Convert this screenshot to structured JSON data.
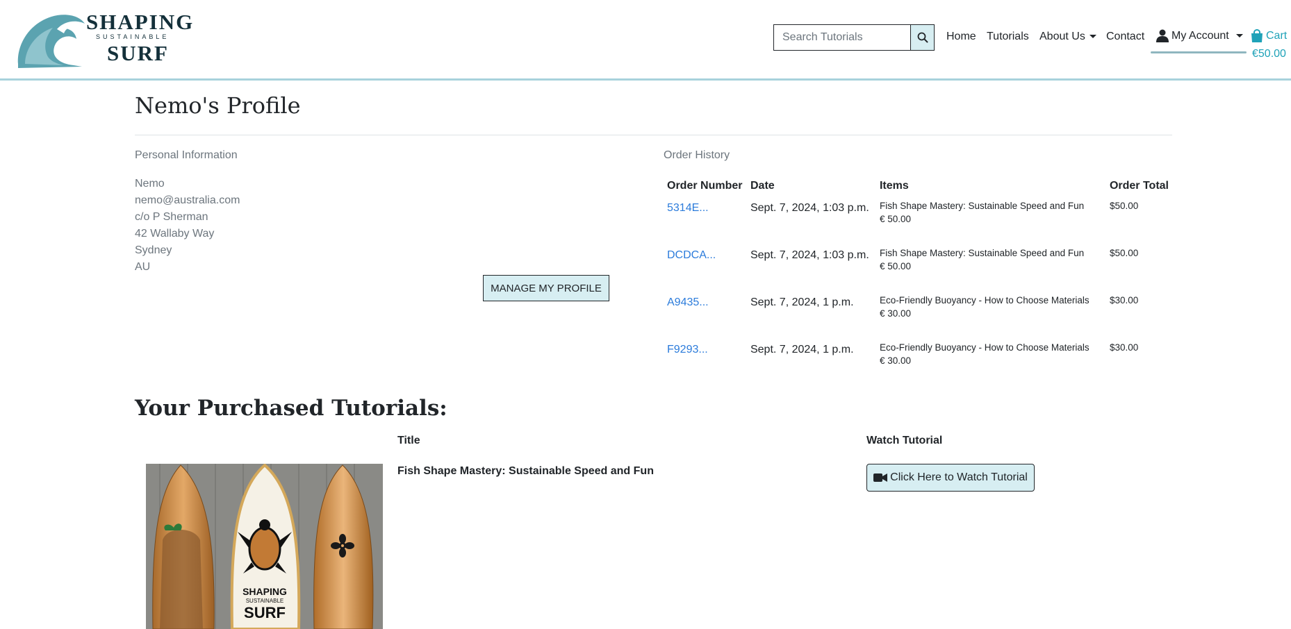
{
  "header": {
    "logo": {
      "line1": "SHAPING",
      "line2": "SUSTAINABLE",
      "line3": "SURF"
    },
    "search": {
      "placeholder": "Search Tutorials"
    },
    "nav": {
      "home": "Home",
      "tutorials": "Tutorials",
      "about": "About Us",
      "contact": "Contact",
      "account": "My Account",
      "cart_label": "Cart",
      "cart_total": "€50.00"
    },
    "colors": {
      "brand": "#1fa2b8",
      "button_bg": "#d7eef2",
      "link": "#2b7bdb"
    }
  },
  "profile": {
    "title": "Nemo's Profile",
    "personal_label": "Personal Information",
    "personal": [
      "Nemo",
      "nemo@australia.com",
      "c/o P Sherman",
      "42 Wallaby Way",
      "Sydney",
      "AU"
    ],
    "manage_button": "MANAGE MY PROFILE"
  },
  "orders": {
    "label": "Order History",
    "columns": [
      "Order Number",
      "Date",
      "Items",
      "Order Total"
    ],
    "rows": [
      {
        "number": "5314E...",
        "date": "Sept. 7, 2024, 1:03 p.m.",
        "item": "Fish Shape Mastery: Sustainable Speed and Fun",
        "item_price": "€ 50.00",
        "total": "$50.00"
      },
      {
        "number": "DCDCA...",
        "date": "Sept. 7, 2024, 1:03 p.m.",
        "item": "Fish Shape Mastery: Sustainable Speed and Fun",
        "item_price": "€ 50.00",
        "total": "$50.00"
      },
      {
        "number": "A9435...",
        "date": "Sept. 7, 2024, 1 p.m.",
        "item": "Eco-Friendly Buoyancy - How to Choose Materials",
        "item_price": "€ 30.00",
        "total": "$30.00"
      },
      {
        "number": "F9293...",
        "date": "Sept. 7, 2024, 1 p.m.",
        "item": "Eco-Friendly Buoyancy - How to Choose Materials",
        "item_price": "€ 30.00",
        "total": "$30.00"
      }
    ]
  },
  "purchased": {
    "title": "Your Purchased Tutorials:",
    "col_title": "Title",
    "col_watch": "Watch Tutorial",
    "items": [
      {
        "title": "Fish Shape Mastery: Sustainable Speed and Fun",
        "watch_label": "Click Here to Watch Tutorial",
        "image_text": [
          "SHAPING",
          "SUSTAINABLE",
          "SURF"
        ]
      }
    ]
  }
}
